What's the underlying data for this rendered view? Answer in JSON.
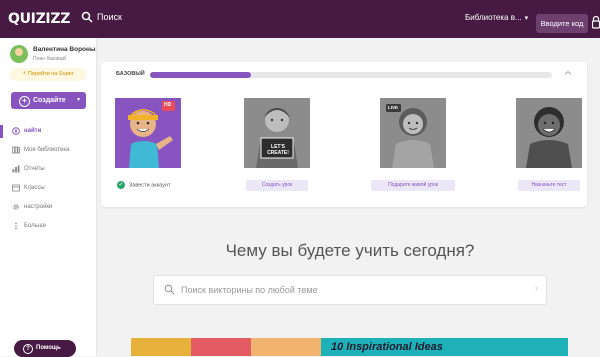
{
  "topbar": {
    "logo": "QUIZIZZ",
    "search_label": "Поиск",
    "library_select": "Библиотека в...",
    "login_button": "Вводите код"
  },
  "sidebar": {
    "user_name": "Валентина Вороны",
    "user_plan": "План базовый",
    "upgrade": "Перейти на Super",
    "create_button": "Создайте",
    "nav": [
      {
        "label": "найти",
        "icon": "compass-icon",
        "active": true
      },
      {
        "label": "Моя библиотека",
        "icon": "library-icon",
        "active": false
      },
      {
        "label": "Отчеты",
        "icon": "reports-icon",
        "active": false
      },
      {
        "label": "Классы",
        "icon": "classes-icon",
        "active": false
      },
      {
        "label": "настройки",
        "icon": "gear-icon",
        "active": false
      },
      {
        "label": "Больше",
        "icon": "more-icon",
        "active": false
      }
    ],
    "help_button": "Помощь"
  },
  "onboarding": {
    "tier_label": "БАЗОВЫЙ",
    "progress": 0.25,
    "done_text": "Завести аккаунт",
    "steps": [
      {
        "cta": "",
        "badge": "HD"
      },
      {
        "cta": "Создать урок",
        "sign": "LET'S CREATE!"
      },
      {
        "cta": "Подарите живой урок",
        "badge": "LIVE"
      },
      {
        "cta": "Назначьте тест"
      }
    ]
  },
  "main": {
    "heading": "Чему вы будете учить сегодня?",
    "search_placeholder": "Поиск викторины по любой теме"
  },
  "banner": {
    "title": "10 Inspirational Ideas"
  },
  "colors": {
    "brand_dark": "#461a42",
    "accent_purple": "#8854c0",
    "success_green": "#2aa56b",
    "banner_teal": "#1fb1b8"
  }
}
